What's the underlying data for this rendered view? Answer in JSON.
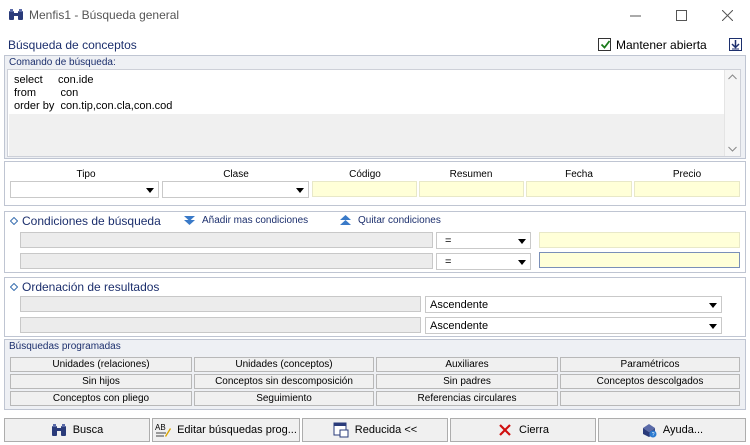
{
  "window": {
    "title": "Menfis1 - Búsqueda general",
    "controls": [
      "minimize-icon",
      "maximize-icon",
      "close-icon"
    ]
  },
  "header": {
    "title": "Búsqueda de conceptos",
    "keep_open_label": "Mantener abierta",
    "keep_open_checked": true
  },
  "command": {
    "label": "Comando de búsqueda:",
    "lines": [
      "select     con.ide",
      "from        con",
      "order by  con.tip,con.cla,con.cod"
    ]
  },
  "filters": {
    "columns": [
      "Tipo",
      "Clase",
      "Código",
      "Resumen",
      "Fecha",
      "Precio"
    ]
  },
  "conditions": {
    "title": "Condiciones de búsqueda",
    "add_label": "Añadir mas condiciones",
    "remove_label": "Quitar condiciones",
    "rows": [
      {
        "operator": "="
      },
      {
        "operator": "="
      }
    ]
  },
  "ordering": {
    "title": "Ordenación de resultados",
    "rows": [
      {
        "direction": "Ascendente"
      },
      {
        "direction": "Ascendente"
      }
    ]
  },
  "programmed": {
    "label": "Búsquedas programadas",
    "rows": [
      [
        "Unidades (relaciones)",
        "Unidades (conceptos)",
        "Auxiliares",
        "Paramétricos"
      ],
      [
        "Sin hijos",
        "Conceptos sin descomposición",
        "Sin padres",
        "Conceptos descolgados"
      ],
      [
        "Conceptos con pliego",
        "Seguimiento",
        "Referencias circulares",
        ""
      ]
    ]
  },
  "footer": {
    "search": "Busca",
    "edit": "Editar búsquedas prog...",
    "reduced": "Reducida <<",
    "close": "Cierra",
    "help": "Ayuda..."
  },
  "colors": {
    "accent": "#1c2f6d",
    "field_yellow": "#ffffd8",
    "button_gray": "#f0f0f0"
  }
}
